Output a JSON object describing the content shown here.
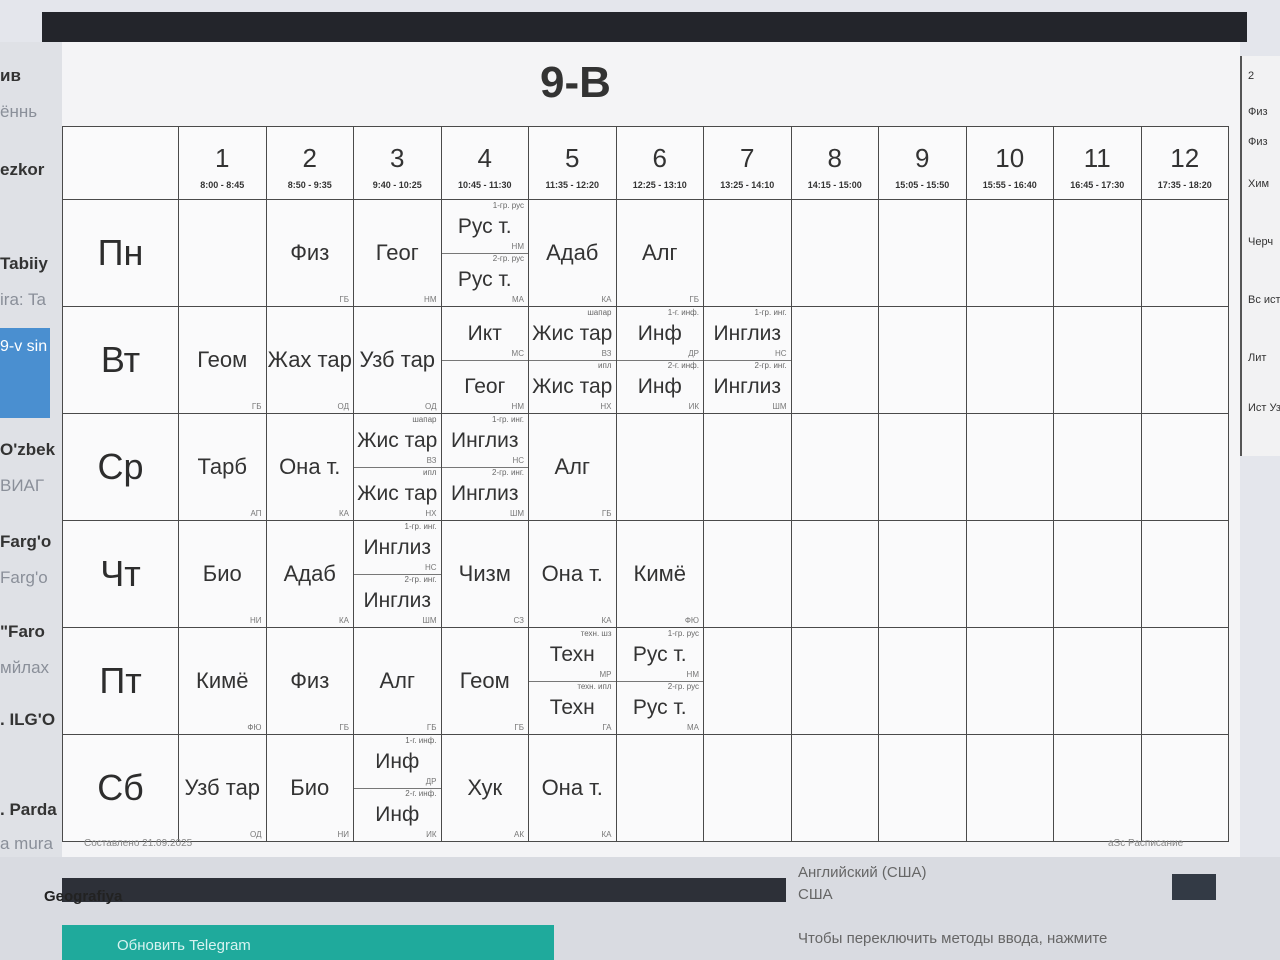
{
  "window": {
    "topbar_color": "#23252b"
  },
  "title": "9-В",
  "days": [
    "Пн",
    "Вт",
    "Ср",
    "Чт",
    "Пт",
    "Сб"
  ],
  "periods": [
    {
      "num": "1",
      "time": "8:00 - 8:45"
    },
    {
      "num": "2",
      "time": "8:50 - 9:35"
    },
    {
      "num": "3",
      "time": "9:40 - 10:25"
    },
    {
      "num": "4",
      "time": "10:45 - 11:30"
    },
    {
      "num": "5",
      "time": "11:35 - 12:20"
    },
    {
      "num": "6",
      "time": "12:25 - 13:10"
    },
    {
      "num": "7",
      "time": "13:25 - 14:10"
    },
    {
      "num": "8",
      "time": "14:15 - 15:00"
    },
    {
      "num": "9",
      "time": "15:05 - 15:50"
    },
    {
      "num": "10",
      "time": "15:55 - 16:40"
    },
    {
      "num": "11",
      "time": "16:45 - 17:30"
    },
    {
      "num": "12",
      "time": "17:35 - 18:20"
    }
  ],
  "schedule": {
    "mon": {
      "p2": {
        "subject": "Физ",
        "teacher": "ГБ"
      },
      "p3": {
        "subject": "Геог",
        "teacher": "НМ"
      },
      "p4": {
        "top": {
          "group": "1-гр. рус",
          "subject": "Рус т.",
          "teacher": "НМ"
        },
        "bottom": {
          "group": "2-гр. рус",
          "subject": "Рус т.",
          "teacher": "МА"
        }
      },
      "p5": {
        "subject": "Адаб",
        "teacher": "КА"
      },
      "p6": {
        "subject": "Алг",
        "teacher": "ГБ"
      }
    },
    "tue": {
      "p1": {
        "subject": "Геом",
        "teacher": "ГБ"
      },
      "p2": {
        "subject": "Жах тар",
        "teacher": "ОД"
      },
      "p3": {
        "subject": "Узб тар",
        "teacher": "ОД"
      },
      "p4": {
        "top": {
          "group": "",
          "subject": "Икт",
          "teacher": "МС"
        },
        "bottom": {
          "group": "",
          "subject": "Геог",
          "teacher": "НМ"
        }
      },
      "p5": {
        "top": {
          "group": "шапар",
          "subject": "Жис тар",
          "teacher": "ВЗ"
        },
        "bottom": {
          "group": "ипл",
          "subject": "Жис тар",
          "teacher": "НХ"
        }
      },
      "p6": {
        "top": {
          "group": "1-г. инф.",
          "subject": "Инф",
          "teacher": "ДР"
        },
        "bottom": {
          "group": "2-г. инф.",
          "subject": "Инф",
          "teacher": "ИК"
        }
      },
      "p7": {
        "top": {
          "group": "1-гр. инг.",
          "subject": "Инглиз",
          "teacher": "НС"
        },
        "bottom": {
          "group": "2-гр. инг.",
          "subject": "Инглиз",
          "teacher": "ШМ"
        }
      }
    },
    "wed": {
      "p1": {
        "subject": "Тарб",
        "teacher": "АП"
      },
      "p2": {
        "subject": "Она т.",
        "teacher": "КА"
      },
      "p3": {
        "top": {
          "group": "шапар",
          "subject": "Жис тар",
          "teacher": "ВЗ"
        },
        "bottom": {
          "group": "ипл",
          "subject": "Жис тар",
          "teacher": "НХ"
        }
      },
      "p4": {
        "top": {
          "group": "1-гр. инг.",
          "subject": "Инглиз",
          "teacher": "НС"
        },
        "bottom": {
          "group": "2-гр. инг.",
          "subject": "Инглиз",
          "teacher": "ШМ"
        }
      },
      "p5": {
        "subject": "Алг",
        "teacher": "ГБ"
      }
    },
    "thu": {
      "p1": {
        "subject": "Био",
        "teacher": "НИ"
      },
      "p2": {
        "subject": "Адаб",
        "teacher": "КА"
      },
      "p3": {
        "top": {
          "group": "1-гр. инг.",
          "subject": "Инглиз",
          "teacher": "НС"
        },
        "bottom": {
          "group": "2-гр. инг.",
          "subject": "Инглиз",
          "teacher": "ШМ"
        }
      },
      "p4": {
        "subject": "Чизм",
        "teacher": "СЗ"
      },
      "p5": {
        "subject": "Она т.",
        "teacher": "КА"
      },
      "p6": {
        "subject": "Кимё",
        "teacher": "ФЮ"
      }
    },
    "fri": {
      "p1": {
        "subject": "Кимё",
        "teacher": "ФЮ"
      },
      "p2": {
        "subject": "Физ",
        "teacher": "ГБ"
      },
      "p3": {
        "subject": "Алг",
        "teacher": "ГБ"
      },
      "p4": {
        "subject": "Геом",
        "teacher": "ГБ"
      },
      "p5": {
        "top": {
          "group": "техн. шз",
          "subject": "Техн",
          "teacher": "МР"
        },
        "bottom": {
          "group": "техн. ипл",
          "subject": "Техн",
          "teacher": "ГА"
        }
      },
      "p6": {
        "top": {
          "group": "1-гр. рус",
          "subject": "Рус т.",
          "teacher": "НМ"
        },
        "bottom": {
          "group": "2-гр. рус",
          "subject": "Рус т.",
          "teacher": "МА"
        }
      }
    },
    "sat": {
      "p1": {
        "subject": "Узб тар",
        "teacher": "ОД"
      },
      "p2": {
        "subject": "Био",
        "teacher": "НИ"
      },
      "p3": {
        "top": {
          "group": "1-г. инф.",
          "subject": "Инф",
          "teacher": "ДР"
        },
        "bottom": {
          "group": "2-г. инф.",
          "subject": "Инф",
          "teacher": "ИК"
        }
      },
      "p4": {
        "subject": "Хук",
        "teacher": "АК"
      },
      "p5": {
        "subject": "Она т.",
        "teacher": "КА"
      }
    }
  },
  "footer": {
    "left": "Составлено 21.09.2025",
    "right": "aSc Расписание"
  },
  "left_strip": [
    "ив",
    "ённь",
    "ezkor",
    "Tabiiy",
    "ira: Ta",
    "9-v sin",
    "O'zbek",
    "ВИАГ",
    "Farg'o",
    "Farg'o",
    "\"Faro",
    "мйлах",
    ". ILG'O",
    ". Parda",
    "a mura"
  ],
  "right_strip": [
    "2",
    "Физ",
    "Физ",
    "Хим",
    "Черч",
    "Вс ист",
    "Лит",
    "Ист Узб"
  ],
  "taskbar": {
    "progress_label": "Geografiya",
    "lang1": "Английский (США)",
    "lang2": "США",
    "hint": "Чтобы переключить методы ввода, нажмите",
    "telegram": "Обновить Telegram"
  }
}
